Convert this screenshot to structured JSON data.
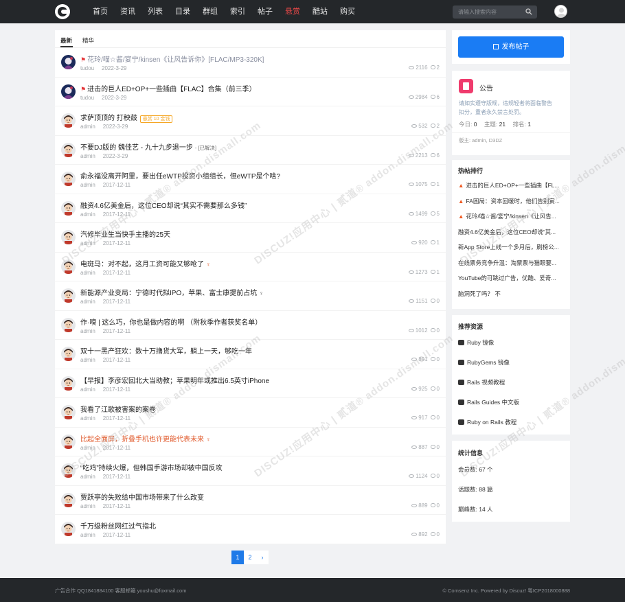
{
  "header": {
    "nav": [
      "首页",
      "资讯",
      "列表",
      "目录",
      "群组",
      "索引",
      "帖子",
      "悬赏",
      "酷站",
      "购买"
    ],
    "active_nav": "悬赏",
    "search_placeholder": "请输入搜索内容"
  },
  "main": {
    "tabs": [
      "最新",
      "精华"
    ],
    "posts": [
      {
        "title": "花玲/喵☆酱/宴宁/kinsen《让风告诉你》[FLAC/MP3-320K]",
        "author": "tudou",
        "date": "2022-3-29",
        "views": "2116",
        "replies": "2",
        "pinned": true,
        "style": "gray",
        "avatar": "anime"
      },
      {
        "title": "进击的巨人ED+OP+一些插曲【FLAC】合集（前三季）",
        "author": "tudou",
        "date": "2022-3-29",
        "views": "2984",
        "replies": "6",
        "pinned": true,
        "style": "normal",
        "avatar": "anime"
      },
      {
        "title": "求萨顶顶的 打秧鼓",
        "author": "admin",
        "date": "2022-3-29",
        "views": "532",
        "replies": "2",
        "badge": "悬赏 10 金钱",
        "avatar": "cartoon"
      },
      {
        "title": "不要DJ版的 魏佳艺 - 九十九步退一步",
        "suffix": "- [已解决]",
        "author": "admin",
        "date": "2022-3-29",
        "views": "2213",
        "replies": "6",
        "avatar": "cartoon"
      },
      {
        "title": "俞永福没离开阿里，要出任eWTP投资小组组长，但eWTP是个啥?",
        "author": "admin",
        "date": "2017-12-11",
        "views": "1075",
        "replies": "1",
        "avatar": "cartoon"
      },
      {
        "title": "融资4.6亿美金后，这位CEO却说“其实不需要那么多钱”",
        "author": "admin",
        "date": "2017-12-11",
        "views": "1499",
        "replies": "5",
        "avatar": "cartoon"
      },
      {
        "title": "汽修毕业生当快手主播的25天",
        "author": "admin",
        "date": "2017-12-11",
        "views": "920",
        "replies": "1",
        "avatar": "cartoon"
      },
      {
        "title": "电斑马：对不起，这月工资可能又够呛了",
        "author": "admin",
        "date": "2017-12-11",
        "views": "1273",
        "replies": "1",
        "ribbon": "red",
        "avatar": "cartoon"
      },
      {
        "title": "新能源产业变局：宁德时代拟IPO，苹果、富士康提前占坑",
        "author": "admin",
        "date": "2017-12-11",
        "views": "1151",
        "replies": "0",
        "ribbon": "dark",
        "avatar": "cartoon"
      },
      {
        "title": "作·嗅 | 这么巧，你也是做内容的啊 （附秋季作者获奖名单）",
        "author": "admin",
        "date": "2017-12-11",
        "views": "1012",
        "replies": "0",
        "avatar": "cartoon"
      },
      {
        "title": "双十一黑产狂欢：数十万撸货大军，躺上一天，够吃一年",
        "author": "admin",
        "date": "2017-12-11",
        "views": "891",
        "replies": "0",
        "avatar": "cartoon"
      },
      {
        "title": "【早报】李彦宏回北大当助教；苹果明年或推出6.5英寸iPhone",
        "author": "admin",
        "date": "2017-12-11",
        "views": "925",
        "replies": "0",
        "avatar": "cartoon"
      },
      {
        "title": "我看了江歌被害案的案卷",
        "author": "admin",
        "date": "2017-12-11",
        "views": "917",
        "replies": "0",
        "avatar": "cartoon"
      },
      {
        "title": "比起全面屏，折叠手机也许更能代表未来",
        "author": "admin",
        "date": "2017-12-11",
        "views": "887",
        "replies": "0",
        "style": "red",
        "ribbon": "red",
        "avatar": "cartoon"
      },
      {
        "title": "“吃鸡”持续火爆，但韩国手游市场却被中国反攻",
        "author": "admin",
        "date": "2017-12-11",
        "views": "1124",
        "replies": "0",
        "avatar": "cartoon"
      },
      {
        "title": "贾跃亭的失败给中国市场带来了什么改变",
        "author": "admin",
        "date": "2017-12-11",
        "views": "889",
        "replies": "0",
        "avatar": "cartoon"
      },
      {
        "title": "千万级粉丝网红过气指北",
        "author": "admin",
        "date": "2017-12-11",
        "views": "892",
        "replies": "0",
        "avatar": "cartoon"
      }
    ],
    "pager": {
      "current": "1",
      "next": "2",
      "arrow": "›"
    }
  },
  "sidebar": {
    "post_button": "发布帖子",
    "notice": {
      "title": "公告",
      "text_line1": "请如实遵守版规，违规轻者将面临警告",
      "text_line2": "扣分，重者永久禁言处罚。",
      "today_label": "今日:",
      "today": "0",
      "topics_label": "主题:",
      "topics": "21",
      "rank_label": "排名:",
      "rank": "1",
      "moderator": "版主: admin, D3DZ"
    },
    "hot": {
      "title": "热帖排行",
      "items": [
        {
          "text": "进击的巨人ED+OP+一些插曲【FL...",
          "fire": true
        },
        {
          "text": "FA困局：资本回暖时，他们告别寅...",
          "fire": true
        },
        {
          "text": "花玲/喵☆酱/宴宁/kinsen《让风告...",
          "fire": true
        },
        {
          "text": "融资4.6亿美金后，这位CEO却说“其...",
          "fire": false
        },
        {
          "text": "新App Store上线一个多月后，刷榜公...",
          "fire": false
        },
        {
          "text": "在线票务竞争升温：淘票票与猫眼要...",
          "fire": false
        },
        {
          "text": "YouTube的可跳过广告，优酷、爱奇...",
          "fire": false
        },
        {
          "text": "脑洞死了吗？ 不",
          "fire": false
        }
      ]
    },
    "resources": {
      "title": "推荐资源",
      "items": [
        "Ruby 镜像",
        "RubyGems 镜像",
        "Rails 视频教程",
        "Rails Guides 中文版",
        "Ruby on Rails 教程"
      ]
    },
    "stats": {
      "title": "统计信息",
      "members": "会员数: 67 个",
      "topics": "话题数: 88 篇",
      "posts": "巅峰数: 14 人"
    }
  },
  "footer": {
    "left": "广告合作 QQ1841884100 客服邮箱 youshu@foxmail.com",
    "right": "© Comsenz Inc. Powered by Discuz! 粤ICP2018000888"
  },
  "watermark": "DISCUZ!应用中心 | 贰道® addon.dismall.com"
}
